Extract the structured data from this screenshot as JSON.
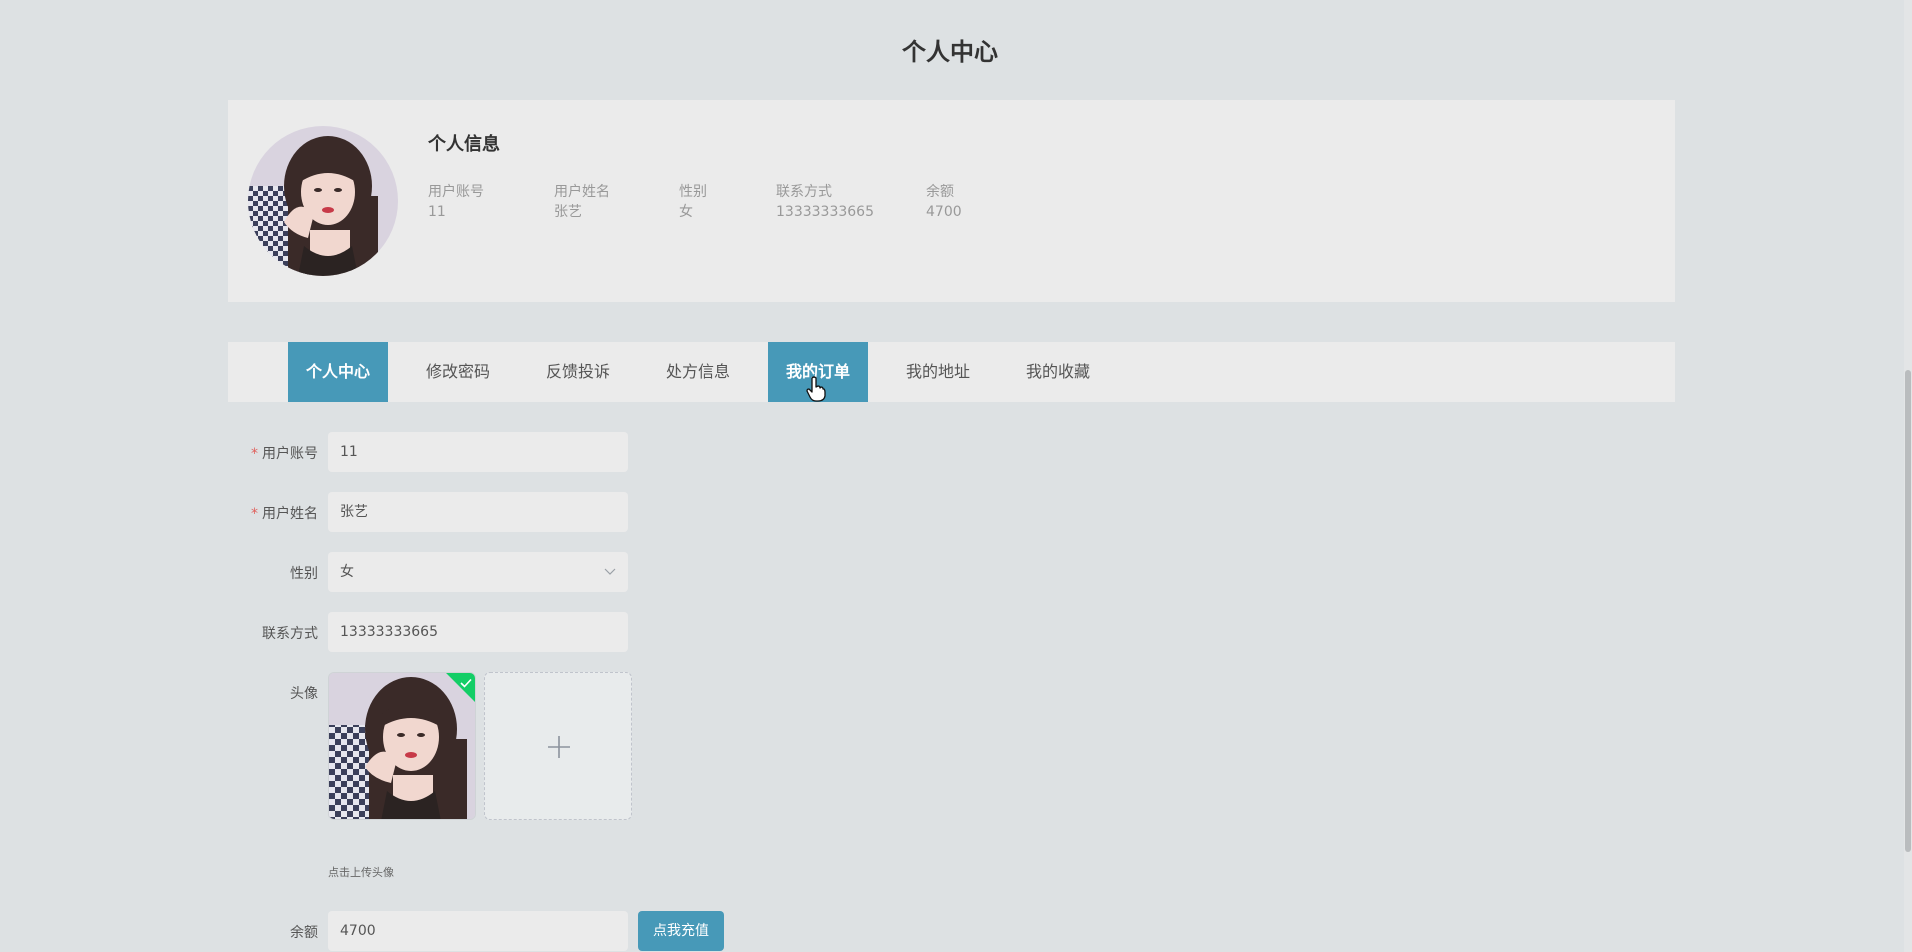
{
  "page": {
    "title": "个人中心"
  },
  "profile": {
    "section_title": "个人信息",
    "fields": [
      {
        "label": "用户账号",
        "value": "11"
      },
      {
        "label": "用户姓名",
        "value": "张艺"
      },
      {
        "label": "性别",
        "value": "女"
      },
      {
        "label": "联系方式",
        "value": "13333333665"
      },
      {
        "label": "余额",
        "value": "4700"
      }
    ]
  },
  "tabs": [
    {
      "label": "个人中心",
      "active": true
    },
    {
      "label": "修改密码",
      "active": false
    },
    {
      "label": "反馈投诉",
      "active": false
    },
    {
      "label": "处方信息",
      "active": false
    },
    {
      "label": "我的订单",
      "active": true
    },
    {
      "label": "我的地址",
      "active": false
    },
    {
      "label": "我的收藏",
      "active": false
    }
  ],
  "form": {
    "account": {
      "label": "用户账号",
      "value": "11",
      "required": "*"
    },
    "name": {
      "label": "用户姓名",
      "value": "张艺",
      "required": "*"
    },
    "gender": {
      "label": "性别",
      "value": "女"
    },
    "phone": {
      "label": "联系方式",
      "value": "13333333665"
    },
    "avatar": {
      "label": "头像",
      "tip": "点击上传头像"
    },
    "balance": {
      "label": "余额",
      "value": "4700",
      "button": "点我充值"
    }
  },
  "colors": {
    "accent": "#4799b8",
    "background": "#dde1e3",
    "panel": "#ebebeb",
    "required": "#e0605c",
    "success": "#13ce66"
  },
  "icons": {
    "select_arrow": "chevron-down-icon",
    "upload_add": "plus-icon",
    "upload_success": "check-icon",
    "cursor": "hand-pointer-icon"
  }
}
